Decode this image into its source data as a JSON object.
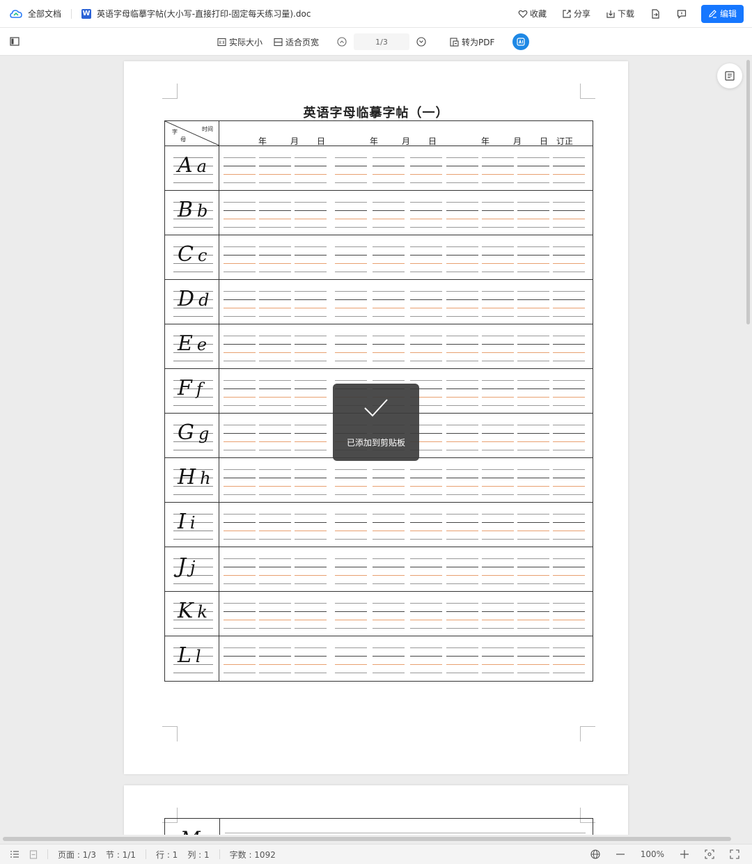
{
  "topbar": {
    "all_docs": "全部文档",
    "word_badge": "W",
    "doc_title": "英语字母临摹字帖(大小写-直接打印-固定每天练习量).doc",
    "favorite": "收藏",
    "share": "分享",
    "download": "下载",
    "edit": "编辑"
  },
  "toolbar": {
    "actual_size": "实际大小",
    "fit_width": "适合页宽",
    "page_indicator": "1/3",
    "to_pdf": "转为PDF"
  },
  "document": {
    "title": "英语字母临摹字帖（一）",
    "header": {
      "zi": "字",
      "mu": "母",
      "time": "时间",
      "year": "年",
      "month": "月",
      "day": "日",
      "correction": "订正"
    },
    "letters": [
      {
        "upper": "A",
        "lower": "a"
      },
      {
        "upper": "B",
        "lower": "b"
      },
      {
        "upper": "C",
        "lower": "c"
      },
      {
        "upper": "D",
        "lower": "d"
      },
      {
        "upper": "E",
        "lower": "e"
      },
      {
        "upper": "F",
        "lower": "f"
      },
      {
        "upper": "G",
        "lower": "g"
      },
      {
        "upper": "H",
        "lower": "h"
      },
      {
        "upper": "I",
        "lower": "i"
      },
      {
        "upper": "J",
        "lower": "j"
      },
      {
        "upper": "K",
        "lower": "k"
      },
      {
        "upper": "L",
        "lower": "l"
      }
    ],
    "next_page_letter": "M"
  },
  "toast": {
    "message": "已添加到剪贴板"
  },
  "statusbar": {
    "page": "页面 : 1/3",
    "section": "节 : 1/1",
    "line": "行 : 1",
    "column": "列 : 1",
    "word_count": "字数 : 1092",
    "zoom": "100%"
  },
  "colors": {
    "accent": "#1677ff",
    "guide_orange": "#e8a070",
    "toast_bg": "#3c3c3c"
  }
}
